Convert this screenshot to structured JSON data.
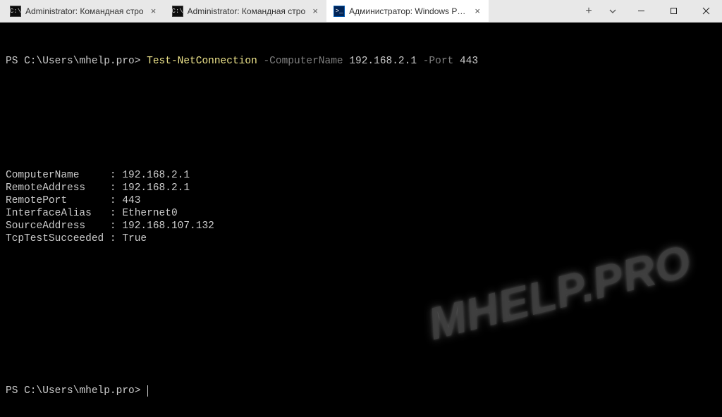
{
  "titlebar": {
    "tabs": [
      {
        "icon": "cmd",
        "label": "Administrator: Командная стро",
        "active": false
      },
      {
        "icon": "cmd",
        "label": "Administrator: Командная стро",
        "active": false
      },
      {
        "icon": "ps",
        "label": "Администратор: Windows Pow",
        "active": true
      }
    ],
    "icon_glyph": {
      "cmd": "C:\\",
      "ps": ">_"
    },
    "newtab_glyph": "+",
    "close_glyph": "×"
  },
  "prompt1": {
    "ps": "PS C:\\Users\\mhelp.pro>",
    "cmdlet": "Test-NetConnection",
    "param1": "-ComputerName",
    "val1": "192.168.2.1",
    "param2": "-Port",
    "val2": "443"
  },
  "output": [
    {
      "key": "ComputerName",
      "val": "192.168.2.1"
    },
    {
      "key": "RemoteAddress",
      "val": "192.168.2.1"
    },
    {
      "key": "RemotePort",
      "val": "443"
    },
    {
      "key": "InterfaceAlias",
      "val": "Ethernet0"
    },
    {
      "key": "SourceAddress",
      "val": "192.168.107.132"
    },
    {
      "key": "TcpTestSucceeded",
      "val": "True"
    }
  ],
  "prompt2": {
    "ps": "PS C:\\Users\\mhelp.pro>"
  },
  "watermark": "MHELP.PRO"
}
